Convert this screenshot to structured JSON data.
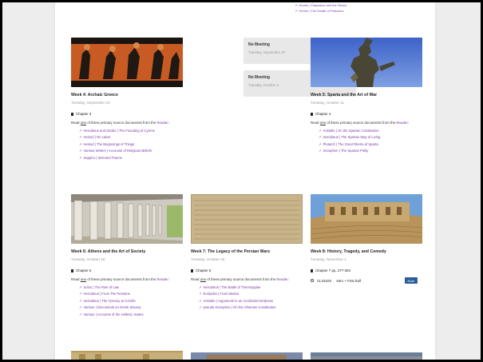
{
  "top_links": [
    "Homer | Odysseus and the Sirens",
    "Homer | The Death of Patroclus"
  ],
  "no_meetings": [
    {
      "title": "No Meeting",
      "date": "Tuesday, September 27"
    },
    {
      "title": "No Meeting",
      "date": "Tuesday, October 4"
    }
  ],
  "common": {
    "desc_pre": "Read ",
    "desc_one": "one",
    "desc_mid": " of these primary source documents from the ",
    "desc_reader": "Reader",
    "desc_end": ":"
  },
  "week4": {
    "title": "Week 4: Archaic Greece",
    "date": "Tuesday, September 20",
    "chapter": "Chapter 3",
    "links": [
      "Herodotus and Strabo | The Founding of Cyrene",
      "Hesiod | On Labor",
      "Hesiod | The Beginnings of Things",
      "Various Writers | Accounts of Religious Beliefs",
      "Sappho | Selected Poems"
    ]
  },
  "week5": {
    "title": "Week 5: Sparta and the Art of War",
    "date": "Tuesday, October 11",
    "chapter": "Chapter 4",
    "links": [
      "Aristotle | On the Spartan Constitution",
      "Herodotus | The Spartan Way of Living",
      "Plutarch | The Good Rhetra of Sparta",
      "Xenophon | The Spartan Polity"
    ]
  },
  "week6": {
    "title": "Week 6: Athens and the Art of Society",
    "date": "Tuesday, October 18",
    "chapter": "Chapter 5",
    "links": [
      "Solon | The Rule of Law",
      "Herodotus | From The Persians",
      "Herodotus | The Tyranny at Corinth",
      "Various | Documents on Greek Slavery",
      "Various | Accounts of the Hellenic States"
    ]
  },
  "week7": {
    "title": "Week 7: The Legacy of the Persian Wars",
    "date": "Tuesday, October 25",
    "chapter": "Chapter 6",
    "links": [
      "Herodotus | The Battle of Thermopylae",
      "Euripides | From Medea",
      "Aristotle | Arguments in an Accidental Kindness",
      "pseudo-Xenophon | On the Athenian Constitution"
    ]
  },
  "week8": {
    "title": "Week 8: History, Tragedy, and Comedy",
    "date": "Tuesday, November 1",
    "chapter": "Chapter 7 pp. 277-303",
    "cloud_label": "CLOUDX",
    "cloud_text": "Intro + First half",
    "note_label": "Note"
  },
  "colors": {
    "link": "#7a3aa6",
    "note_button": "#2a5d9a"
  }
}
